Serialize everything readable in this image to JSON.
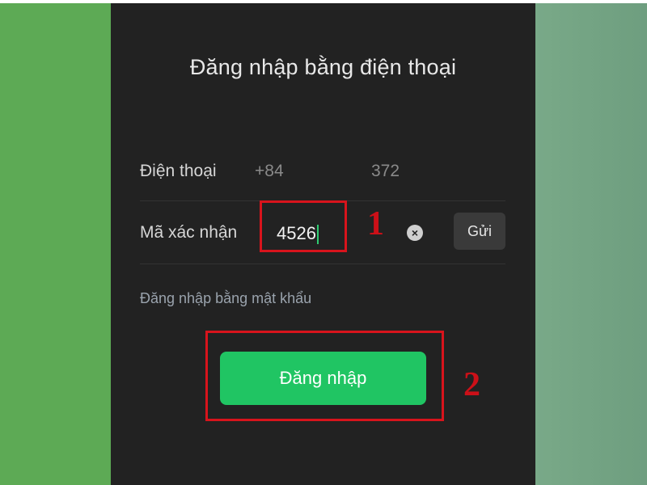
{
  "screen": {
    "title": "Đăng nhập bằng điện thoại"
  },
  "phone_row": {
    "label": "Điện thoại",
    "country_code": "+84",
    "number_partial": "372"
  },
  "code_row": {
    "label": "Mã xác nhận",
    "value": "4526",
    "send_label": "Gửi",
    "clear_glyph": "×"
  },
  "links": {
    "password_login": "Đăng nhập bằng mật khẩu"
  },
  "login_button": {
    "label": "Đăng nhập"
  },
  "annotations": {
    "step1": "1",
    "step2": "2"
  },
  "icons": {
    "clear": "clear-icon",
    "cursor": "text-cursor"
  },
  "colors": {
    "accent_green": "#20c563",
    "highlight_red": "#d8141c",
    "panel_bg": "#222222"
  }
}
